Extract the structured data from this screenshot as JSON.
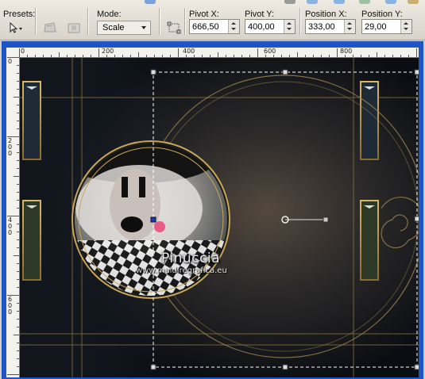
{
  "toolbar": {
    "presets_label": "Presets:",
    "mode_label": "Mode:",
    "mode_value": "Scale",
    "pivot_x_label": "Pivot X:",
    "pivot_x_value": "666,50",
    "pivot_y_label": "Pivot Y:",
    "pivot_y_value": "400,00",
    "position_x_label": "Position X:",
    "position_x_value": "333,00",
    "position_y_label": "Position Y:",
    "position_y_value": "29,00",
    "icons": [
      "pointer-preset-icon",
      "deform-tool-icon",
      "perspective-tool-icon",
      "transform-options-icon"
    ]
  },
  "ruler": {
    "top_labels": [
      "0",
      "200",
      "400",
      "600",
      "800"
    ],
    "left_labels": [
      "0",
      "200",
      "400",
      "600"
    ]
  },
  "canvas": {
    "watermark_name": "Pinuccia",
    "watermark_url": "www.maidiregrafica.eu"
  },
  "colors": {
    "window_frame": "#1d54c6",
    "gold_line": "#b89a4e",
    "background_dark": "#0c0f14"
  }
}
